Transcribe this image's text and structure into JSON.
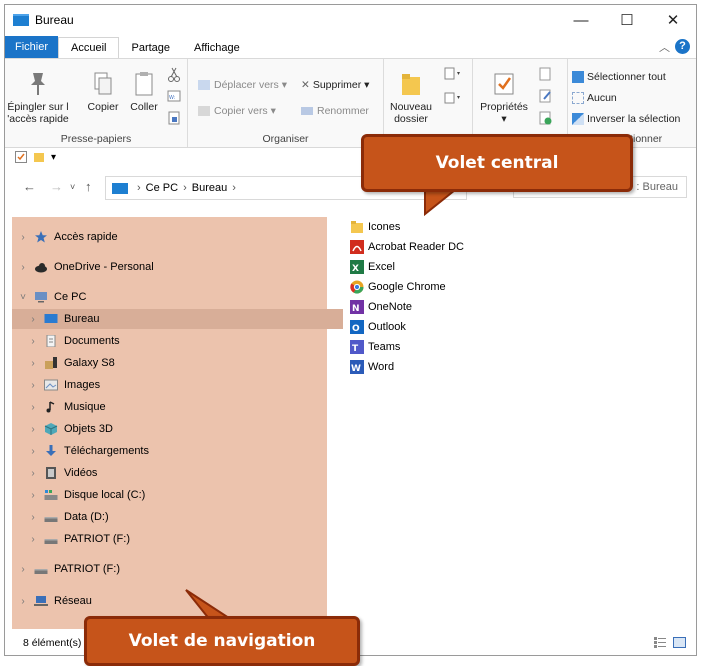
{
  "window": {
    "title": "Bureau",
    "controls": [
      "—",
      "☐",
      "✕"
    ]
  },
  "tabs": [
    {
      "label": "Fichier"
    },
    {
      "label": "Accueil"
    },
    {
      "label": "Partage"
    },
    {
      "label": "Affichage"
    }
  ],
  "ribbon": {
    "pin_label_line1": "Épingler sur l",
    "pin_label_line2": "'accès rapide",
    "copy_label": "Copier",
    "paste_label": "Coller",
    "clipboard_group": "Presse-papiers",
    "move_to_label": "Déplacer vers",
    "copy_to_label": "Copier vers",
    "delete_label": "Supprimer",
    "rename_label": "Renommer",
    "organize_group": "Organiser",
    "new_folder_line1": "Nouveau",
    "new_folder_line2": "dossier",
    "new_group_partial": "N",
    "properties_label": "Propriétés",
    "open_group_partial": "O",
    "select_all_label": "Sélectionner tout",
    "select_none_label": "Aucun",
    "invert_selection_label": "Inverser la sélection",
    "select_group_partial": "Sélectionner"
  },
  "address": {
    "path": [
      "Ce PC",
      "Bureau"
    ],
    "search_placeholder_partial": ": Bureau"
  },
  "nav": {
    "items": [
      {
        "label": "Accès rapide",
        "icon": "star-icon"
      },
      {
        "label": "OneDrive - Personal",
        "icon": "cloud-icon"
      },
      {
        "label": "Ce PC",
        "icon": "computer-icon"
      },
      {
        "label": "Bureau",
        "icon": "desktop-icon"
      },
      {
        "label": "Documents",
        "icon": "documents-icon"
      },
      {
        "label": "Galaxy S8",
        "icon": "phone-icon"
      },
      {
        "label": "Images",
        "icon": "images-icon"
      },
      {
        "label": "Musique",
        "icon": "music-icon"
      },
      {
        "label": "Objets 3D",
        "icon": "cube-icon"
      },
      {
        "label": "Téléchargements",
        "icon": "download-icon"
      },
      {
        "label": "Vidéos",
        "icon": "video-icon"
      },
      {
        "label": "Disque local (C:)",
        "icon": "drive-icon"
      },
      {
        "label": "Data (D:)",
        "icon": "drive-icon"
      },
      {
        "label": "PATRIOT (F:)",
        "icon": "usb-drive-icon"
      },
      {
        "label": "PATRIOT (F:)",
        "icon": "usb-drive-icon"
      },
      {
        "label": "Réseau",
        "icon": "network-icon"
      }
    ]
  },
  "files": [
    {
      "label": "Icones",
      "icon": "folder-icon",
      "color": "#f2c94c"
    },
    {
      "label": "Acrobat Reader DC",
      "icon": "acrobat-icon",
      "color": "#d12d1e"
    },
    {
      "label": "Excel",
      "icon": "excel-icon",
      "color": "#1f7a45"
    },
    {
      "label": "Google Chrome",
      "icon": "chrome-icon",
      "color": "#e8a423"
    },
    {
      "label": "OneNote",
      "icon": "onenote-icon",
      "color": "#7232a5"
    },
    {
      "label": "Outlook",
      "icon": "outlook-icon",
      "color": "#1367c2"
    },
    {
      "label": "Teams",
      "icon": "teams-icon",
      "color": "#5059c9"
    },
    {
      "label": "Word",
      "icon": "word-icon",
      "color": "#2b5bb8"
    }
  ],
  "status": {
    "item_count": "8 élément(s)"
  },
  "callouts": {
    "central": "Volet central",
    "navigation": "Volet de navigation"
  },
  "colors": {
    "accent": "#1b74c8",
    "nav_highlight": "#ecc3ad",
    "callout_fill": "#c6541a",
    "callout_border": "#8b2b08"
  }
}
